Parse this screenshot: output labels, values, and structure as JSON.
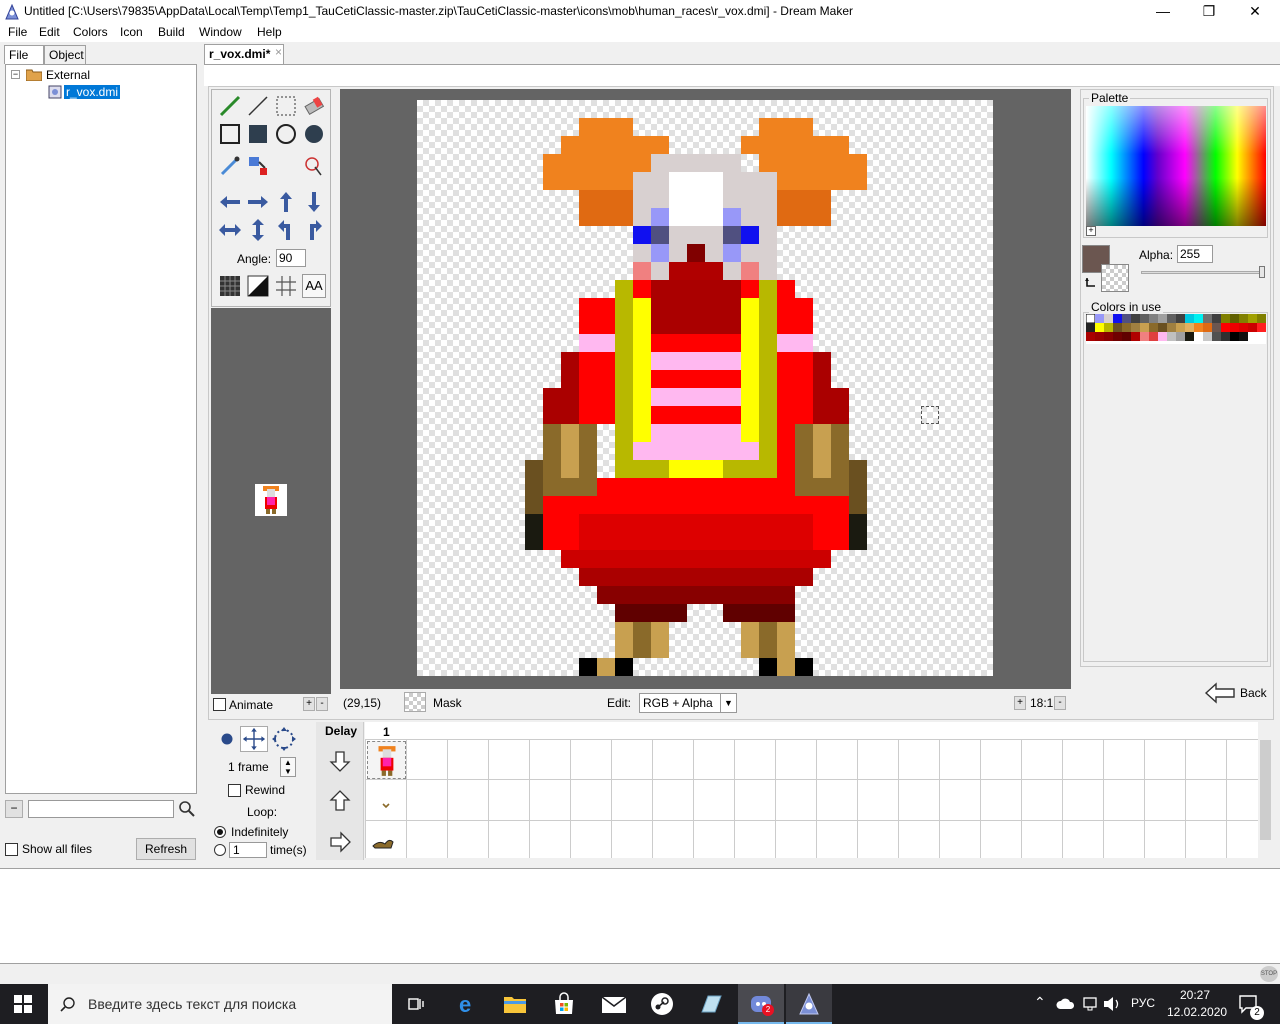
{
  "window": {
    "title": "Untitled [C:\\Users\\79835\\AppData\\Local\\Temp\\Temp1_TauCetiClassic-master.zip\\TauCetiClassic-master\\icons\\mob\\human_races\\r_vox.dmi] - Dream Maker",
    "min_glyph": "—",
    "max_glyph": "❐",
    "close_glyph": "✕"
  },
  "menu": [
    "File",
    "Edit",
    "Colors",
    "Icon",
    "Build",
    "Window",
    "Help"
  ],
  "left_panel": {
    "tabs": [
      "File",
      "Object"
    ],
    "tree": {
      "root": "External",
      "child": "r_vox.dmi"
    },
    "show_all_files": "Show all files",
    "refresh": "Refresh"
  },
  "editor_tab": {
    "label": "r_vox.dmi*",
    "close": "×"
  },
  "toolbox": {
    "angle_label": "Angle:",
    "angle_value": "90",
    "aa_label": "AA"
  },
  "preview": {
    "animate_label": "Animate",
    "plus": "+",
    "minus": "-"
  },
  "status": {
    "coords": "(29,15)",
    "mask_label": "Mask",
    "edit_label": "Edit:",
    "edit_value": "RGB + Alpha",
    "zoom": "18:1",
    "plus": "+",
    "minus": "-"
  },
  "right_panel": {
    "palette_label": "Palette",
    "alpha_label": "Alpha:",
    "alpha_value": "255",
    "colors_in_use_label": "Colors in use",
    "back_label": "Back",
    "current_color": "#6b5650"
  },
  "frames": {
    "frame_count": "1 frame",
    "rewind": "Rewind",
    "loop": "Loop:",
    "indefinitely": "Indefinitely",
    "times_value": "1",
    "times_label": "time(s)",
    "delay_header": "Delay",
    "column_1": "1"
  },
  "taskbar": {
    "search_placeholder": "Введите здесь текст для поиска",
    "language": "РУС",
    "time": "20:27",
    "date": "12.02.2020",
    "notification_count": "2"
  }
}
